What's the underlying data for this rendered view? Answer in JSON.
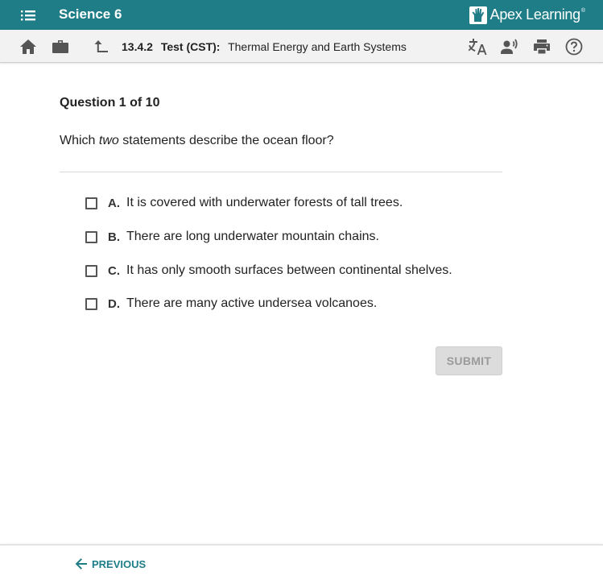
{
  "header": {
    "course_title": "Science 6",
    "brand_name": "Apex Learning",
    "brand_tm": "®",
    "brand_color": "#1e7d87"
  },
  "toolbar": {
    "left_icons": [
      "home-icon",
      "briefcase-icon",
      "up-level-icon"
    ],
    "right_icons": [
      "translate-icon",
      "text-to-speech-icon",
      "print-icon",
      "help-icon"
    ],
    "breadcrumb": {
      "code": "13.4.2",
      "type": "Test (CST):",
      "title": "Thermal Energy and Earth Systems"
    }
  },
  "question": {
    "label": "Question 1 of 10",
    "prompt_prefix": "Which",
    "prompt_emphasis": "two",
    "prompt_suffix": "statements describe the ocean floor?",
    "options": [
      {
        "letter": "A.",
        "text": "It is covered with underwater forests of tall trees.",
        "checked": false
      },
      {
        "letter": "B.",
        "text": "There are long underwater mountain chains.",
        "checked": false
      },
      {
        "letter": "C.",
        "text": "It has only smooth surfaces between continental shelves.",
        "checked": false
      },
      {
        "letter": "D.",
        "text": "There are many active undersea volcanoes.",
        "checked": false
      }
    ],
    "submit_label": "SUBMIT"
  },
  "footer": {
    "previous_label": "PREVIOUS"
  }
}
